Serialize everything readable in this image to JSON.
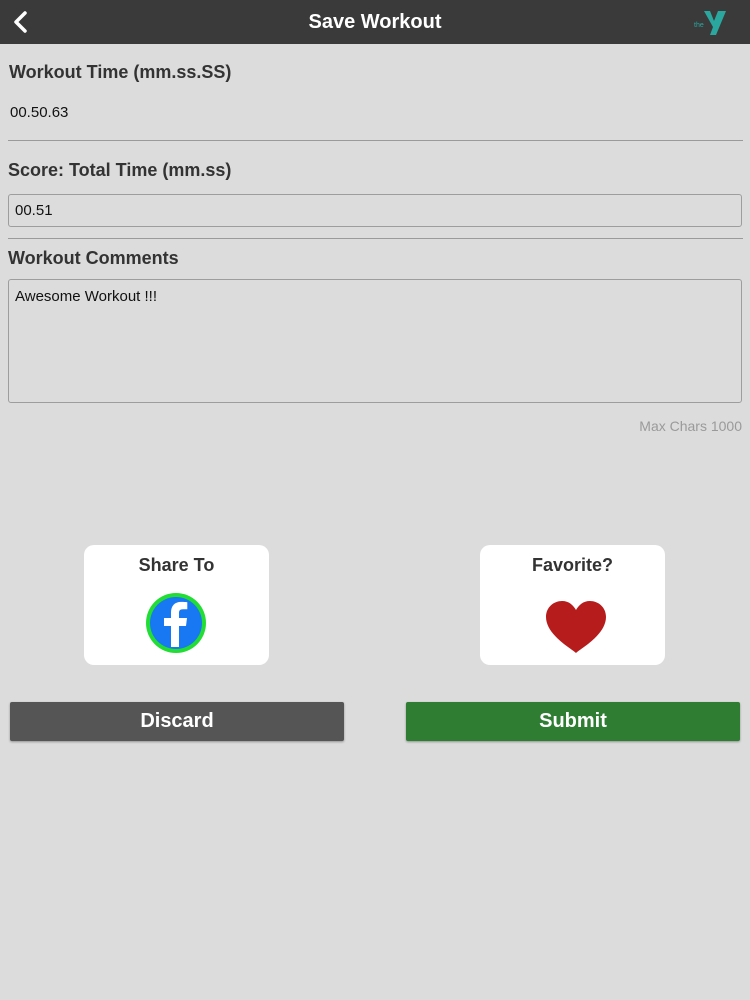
{
  "header": {
    "title": "Save Workout",
    "back_icon": "chevron-left-icon",
    "logo_text": "the",
    "logo_icon": "ymca-logo-icon"
  },
  "workout_time": {
    "label": "Workout Time (mm.ss.SS)",
    "value": "00.50.63"
  },
  "score": {
    "label": "Score: Total Time (mm.ss)",
    "value": "00.51"
  },
  "comments": {
    "label": "Workout Comments",
    "value": "Awesome Workout !!!",
    "max_chars_label": "Max Chars 1000"
  },
  "share": {
    "label": "Share To",
    "icon": "facebook-icon"
  },
  "favorite": {
    "label": "Favorite?",
    "icon": "heart-icon"
  },
  "actions": {
    "discard_label": "Discard",
    "submit_label": "Submit"
  },
  "colors": {
    "topbar": "#3a3a3a",
    "background": "#dcdcdc",
    "discard": "#555555",
    "submit": "#2e7d32",
    "facebook": "#1877f2",
    "facebook_ring": "#22dd33",
    "heart": "#b71c1c"
  }
}
